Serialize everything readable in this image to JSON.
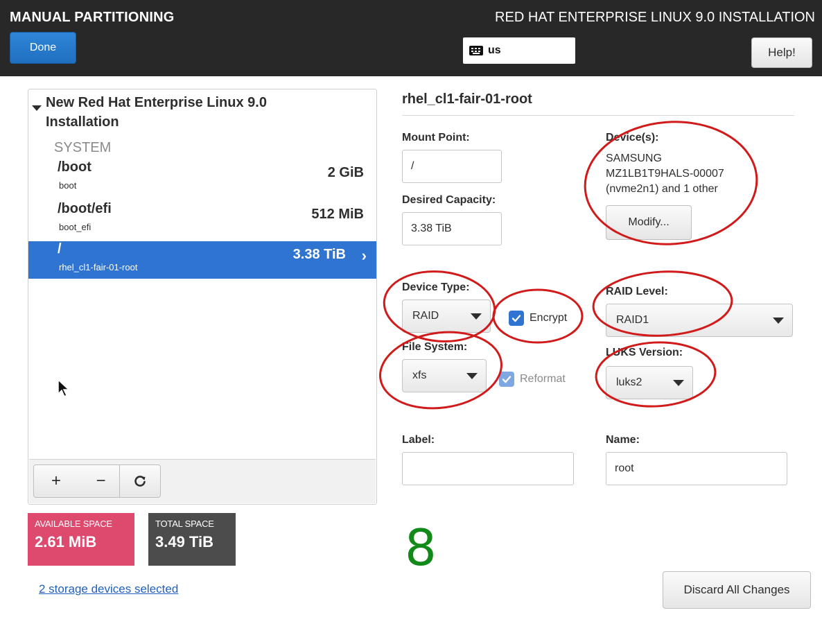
{
  "header": {
    "title": "MANUAL PARTITIONING",
    "product": "RED HAT ENTERPRISE LINUX 9.0 INSTALLATION",
    "done_label": "Done",
    "keyboard_layout": "us",
    "help_label": "Help!",
    "keyboard_icon": "keyboard-icon"
  },
  "left_panel": {
    "installation_title": "New Red Hat Enterprise Linux 9.0 Installation",
    "group_label": "SYSTEM",
    "mounts": [
      {
        "name": "/boot",
        "device": "boot",
        "size": "2 GiB",
        "selected": false
      },
      {
        "name": "/boot/efi",
        "device": "boot_efi",
        "size": "512 MiB",
        "selected": false
      },
      {
        "name": "/",
        "device": "rhel_cl1-fair-01-root",
        "size": "3.38 TiB",
        "selected": true
      }
    ],
    "toolbar": {
      "add": "+",
      "remove": "−",
      "refresh": "C"
    },
    "available_space": {
      "label": "AVAILABLE SPACE",
      "value": "2.61 MiB",
      "color": "#dd4a6e"
    },
    "total_space": {
      "label": "TOTAL SPACE",
      "value": "3.49 TiB",
      "color": "#4c4c4c"
    },
    "storage_link": "2 storage devices selected"
  },
  "details": {
    "title": "rhel_cl1-fair-01-root",
    "mount_point_label": "Mount Point:",
    "mount_point_value": "/",
    "desired_capacity_label": "Desired Capacity:",
    "desired_capacity_value": "3.38 TiB",
    "devices_label": "Device(s):",
    "devices_lines": [
      "SAMSUNG",
      "MZ1LB1T9HALS-00007",
      "(nvme2n1) and 1 other"
    ],
    "modify_label": "Modify...",
    "device_type_label": "Device Type:",
    "device_type_value": "RAID",
    "encrypt_label": "Encrypt",
    "encrypt_checked": true,
    "raid_level_label": "RAID Level:",
    "raid_level_value": "RAID1",
    "file_system_label": "File System:",
    "file_system_value": "xfs",
    "reformat_label": "Reformat",
    "reformat_checked": true,
    "luks_version_label": "LUKS Version:",
    "luks_version_value": "luks2",
    "label_label": "Label:",
    "label_value": "",
    "name_label": "Name:",
    "name_value": "root",
    "discard_label": "Discard All Changes"
  },
  "annotation": {
    "number": "8",
    "color": "#128a1a",
    "circle_color": "#d11a1a"
  }
}
